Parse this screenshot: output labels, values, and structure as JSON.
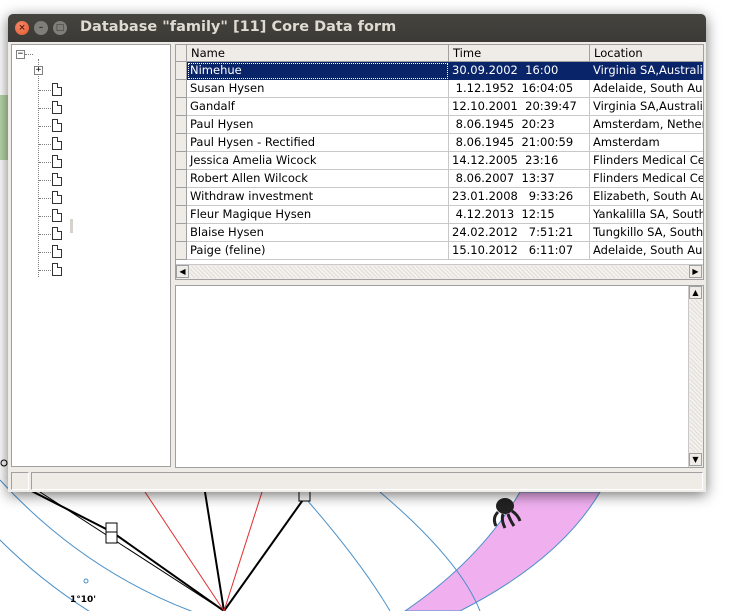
{
  "window": {
    "title": "Database \"family\"  [11]  Core Data form",
    "close_glyph": "×",
    "min_glyph": "–",
    "max_glyph": "□"
  },
  "tree": {
    "root_toggle": "−",
    "node_toggle": "+",
    "leaf_count": 11
  },
  "grid": {
    "columns": [
      "Name",
      "Time",
      "Location"
    ],
    "selected_index": 0,
    "rows": [
      {
        "name": "Nimehue",
        "time": "30.09.2002  16:00",
        "location": "Virginia SA,Australia"
      },
      {
        "name": "Susan Hysen",
        "time": " 1.12.1952  16:04:05",
        "location": "Adelaide, South Australia"
      },
      {
        "name": "Gandalf",
        "time": "12.10.2001  20:39:47",
        "location": "Virginia SA,Australia"
      },
      {
        "name": "Paul Hysen",
        "time": " 8.06.1945  20:23",
        "location": "Amsterdam, Netherlands"
      },
      {
        "name": "Paul Hysen - Rectified",
        "time": " 8.06.1945  21:00:59",
        "location": "Amsterdam"
      },
      {
        "name": "Jessica Amelia Wicock",
        "time": "14.12.2005  23:16",
        "location": "Flinders Medical Centre"
      },
      {
        "name": "Robert Allen Wilcock",
        "time": " 8.06.2007  13:37",
        "location": "Flinders Medical Centre"
      },
      {
        "name": "Withdraw investment",
        "time": "23.01.2008   9:33:26",
        "location": "Elizabeth, South Australia"
      },
      {
        "name": "Fleur Magique Hysen",
        "time": " 4.12.2013  12:15",
        "location": "Yankalilla SA, South Australia"
      },
      {
        "name": "Blaise Hysen",
        "time": "24.02.2012   7:51:21",
        "location": "Tungkillo SA, South Australia"
      },
      {
        "name": "Paige (feline)",
        "time": "15.10.2012   6:11:07",
        "location": "Adelaide, South Australia"
      }
    ],
    "scroll_left": "◀",
    "scroll_right": "▶"
  },
  "memo": {
    "text": "",
    "scroll_up": "▲",
    "scroll_down": "▼"
  },
  "background": {
    "label": "1°10'",
    "colors": {
      "ring_line": "#4a90c8",
      "pink_band": "#f0b0f0",
      "red_line": "#e03030",
      "green_arc": "#b8d8a8"
    }
  }
}
